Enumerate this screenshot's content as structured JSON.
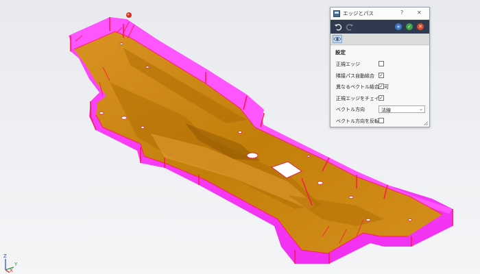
{
  "dialog": {
    "title": "エッジとパス",
    "help_symbol": "?",
    "close_symbol": "✕",
    "section_title": "設定",
    "options": [
      {
        "label": "正規エッジ",
        "checked": false
      },
      {
        "label": "隣接パス自動結合",
        "checked": true
      },
      {
        "label": "異なるベクトル結合許可",
        "checked": true
      },
      {
        "label": "正規エッジをチェイン",
        "checked": true
      }
    ],
    "direction": {
      "label": "ベクトル方向",
      "value": "法線"
    },
    "reverse": {
      "label": "ベクトル方向を反転",
      "checked": false
    }
  },
  "triad": {
    "z": "Z",
    "y": "Y",
    "x": "X"
  },
  "icons": {
    "app": "app-icon",
    "undo": "undo-icon",
    "redo": "redo-icon",
    "ok": "ok-icon",
    "cancel": "cancel-icon",
    "back": "back-icon",
    "view": "eye-icon"
  },
  "colors": {
    "part": "#cf8a10",
    "wall": "#ff2eff",
    "edge": "#ff1a4a",
    "toolbar": "#2f3a4f",
    "ok": "#3fa34d",
    "cancel": "#d9482b",
    "back": "#3e79c7"
  }
}
